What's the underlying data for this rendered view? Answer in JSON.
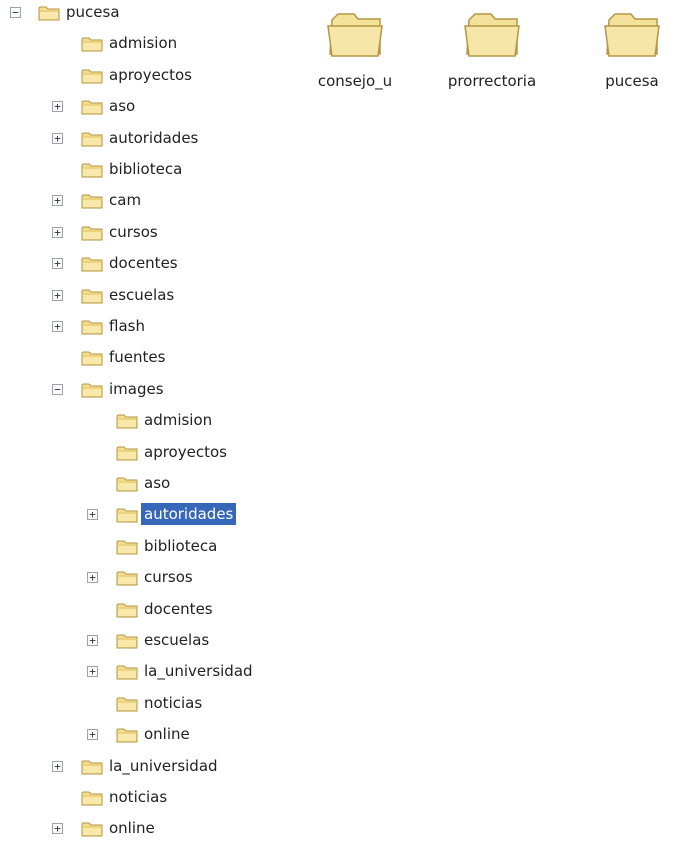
{
  "tree": {
    "items": [
      {
        "label": "pucesa",
        "level": 0,
        "expander": "minus"
      },
      {
        "label": "admision",
        "level": 1,
        "expander": null
      },
      {
        "label": "aproyectos",
        "level": 1,
        "expander": null
      },
      {
        "label": "aso",
        "level": 1,
        "expander": "plus"
      },
      {
        "label": "autoridades",
        "level": 1,
        "expander": "plus"
      },
      {
        "label": "biblioteca",
        "level": 1,
        "expander": null
      },
      {
        "label": "cam",
        "level": 1,
        "expander": "plus"
      },
      {
        "label": "cursos",
        "level": 1,
        "expander": "plus"
      },
      {
        "label": "docentes",
        "level": 1,
        "expander": "plus"
      },
      {
        "label": "escuelas",
        "level": 1,
        "expander": "plus"
      },
      {
        "label": "flash",
        "level": 1,
        "expander": "plus"
      },
      {
        "label": "fuentes",
        "level": 1,
        "expander": null
      },
      {
        "label": "images",
        "level": 1,
        "expander": "minus"
      },
      {
        "label": "admision",
        "level": 2,
        "expander": null
      },
      {
        "label": "aproyectos",
        "level": 2,
        "expander": null
      },
      {
        "label": "aso",
        "level": 2,
        "expander": null
      },
      {
        "label": "autoridades",
        "level": 2,
        "expander": "plus",
        "selected": true
      },
      {
        "label": "biblioteca",
        "level": 2,
        "expander": null
      },
      {
        "label": "cursos",
        "level": 2,
        "expander": "plus"
      },
      {
        "label": "docentes",
        "level": 2,
        "expander": null
      },
      {
        "label": "escuelas",
        "level": 2,
        "expander": "plus"
      },
      {
        "label": "la_universidad",
        "level": 2,
        "expander": "plus"
      },
      {
        "label": "noticias",
        "level": 2,
        "expander": null
      },
      {
        "label": "online",
        "level": 2,
        "expander": "plus"
      },
      {
        "label": "la_universidad",
        "level": 1,
        "expander": "plus"
      },
      {
        "label": "noticias",
        "level": 1,
        "expander": null
      },
      {
        "label": "online",
        "level": 1,
        "expander": "plus"
      }
    ]
  },
  "panel": {
    "items": [
      {
        "label": "consejo_u"
      },
      {
        "label": "prorrectoria"
      },
      {
        "label": "pucesa"
      }
    ]
  },
  "colors": {
    "selection": "#3767b8",
    "folder_fill": "#f3dd8f",
    "folder_outline": "#b59646"
  }
}
